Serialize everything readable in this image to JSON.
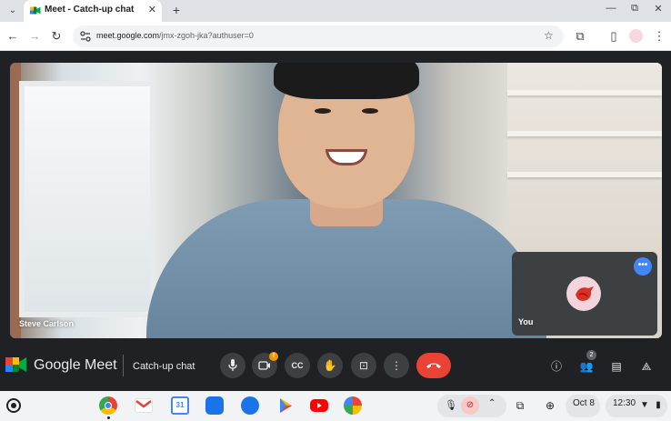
{
  "browser": {
    "tab_title": "Meet - Catch-up chat",
    "tab_close": "✕",
    "new_tab": "+",
    "tab_menu": "⌄",
    "url_host": "meet.google.com",
    "url_path": "/jmx-zgoh-jka?authuser=0",
    "window_buttons": [
      "—",
      "⧉",
      "✕"
    ]
  },
  "meet": {
    "participant_name": "Steve Carlson",
    "self_label": "You",
    "self_more": "•••",
    "brand_name": "Google Meet",
    "meeting_name": "Catch-up chat",
    "camera_alert": "!",
    "people_count": "2",
    "colors": {
      "end_call": "#ea4335",
      "accent": "#4285f4",
      "alert": "#f29900"
    }
  },
  "shelf": {
    "date": "Oct 8",
    "time": "12:30",
    "apps": [
      "chrome-icon",
      "gmail-icon",
      "calendar-icon",
      "files-icon",
      "messages-icon",
      "play-store-icon",
      "youtube-icon",
      "photos-icon"
    ]
  }
}
